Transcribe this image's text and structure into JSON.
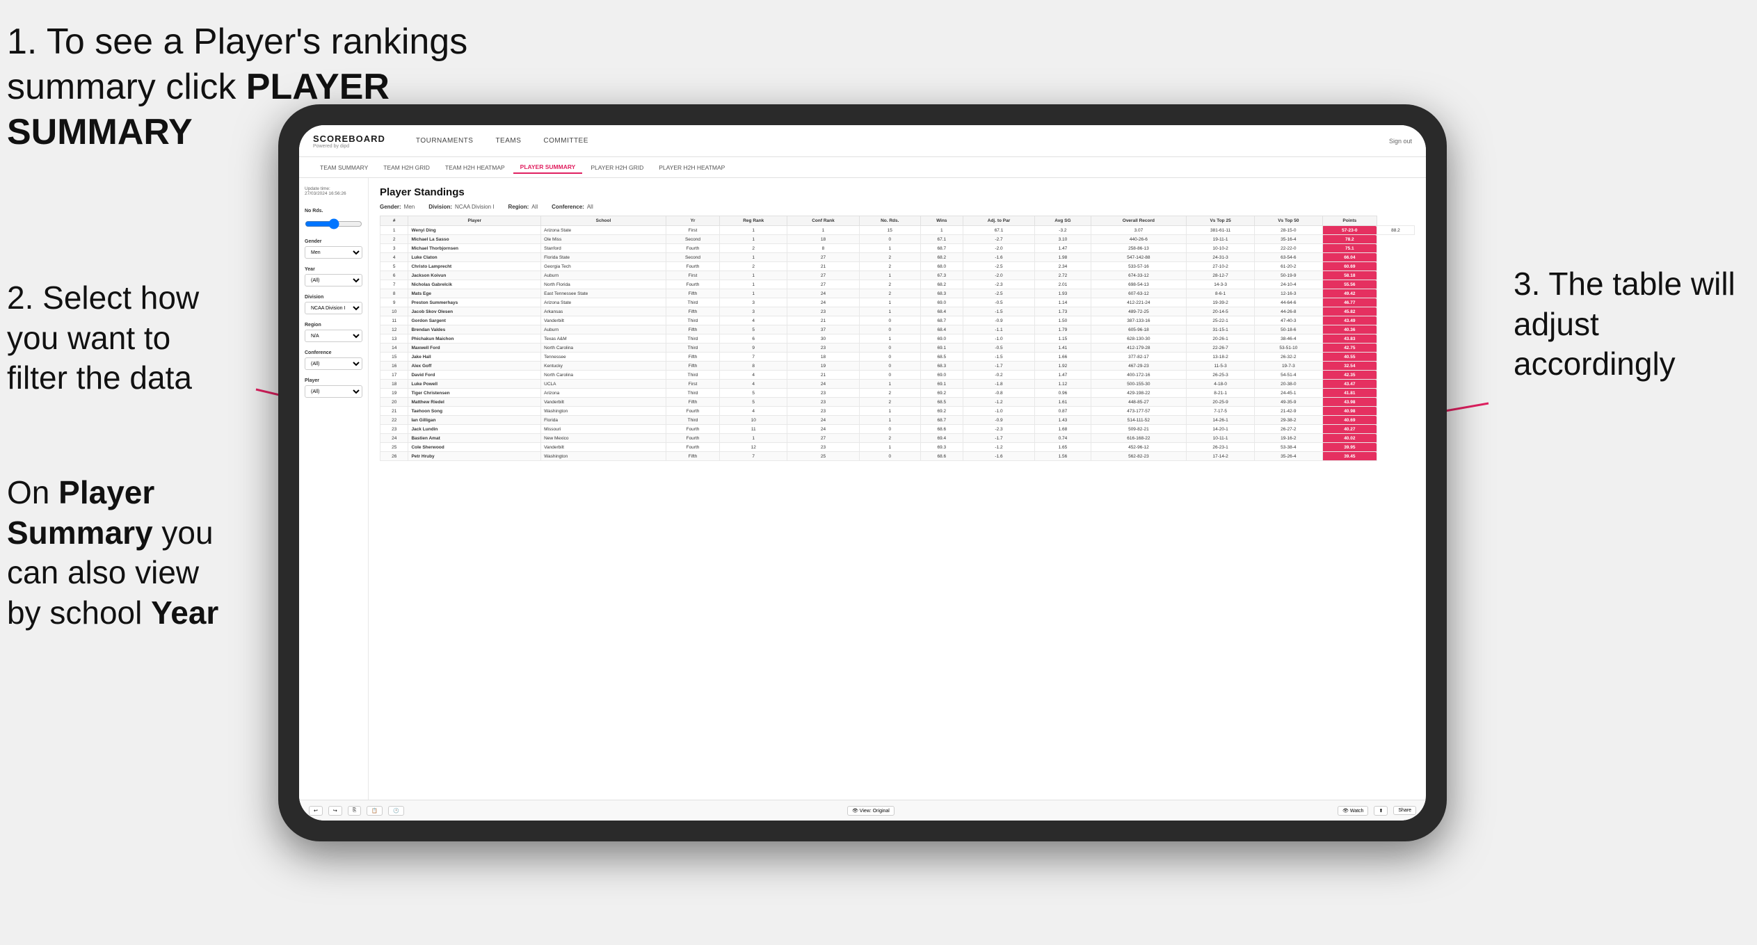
{
  "instructions": {
    "step1": {
      "text": "1. To see a Player's rankings summary click ",
      "bold": "PLAYER SUMMARY"
    },
    "step2": {
      "text": "2. Select how you want to filter the data"
    },
    "step3": {
      "text": "3. The table will adjust accordingly"
    },
    "step_bottom": {
      "prefix": "On ",
      "bold1": "Player Summary",
      "middle": " you can also view by school ",
      "bold2": "Year"
    }
  },
  "header": {
    "logo": "SCOREBOARD",
    "logo_sub": "Powered by dipd",
    "nav": [
      "TOURNAMENTS",
      "TEAMS",
      "COMMITTEE"
    ],
    "sign_in": "Sign out"
  },
  "subnav": {
    "items": [
      "TEAM SUMMARY",
      "TEAM H2H GRID",
      "TEAM H2H HEATMAP",
      "PLAYER SUMMARY",
      "PLAYER H2H GRID",
      "PLAYER H2H HEATMAP"
    ],
    "active": "PLAYER SUMMARY"
  },
  "sidebar": {
    "update_label": "Update time:",
    "update_time": "27/03/2024 16:56:26",
    "no_rds_label": "No Rds.",
    "gender_label": "Gender",
    "gender_value": "Men",
    "year_label": "Year",
    "year_value": "(All)",
    "division_label": "Division",
    "division_value": "NCAA Division I",
    "region_label": "Region",
    "region_value": "N/A",
    "conference_label": "Conference",
    "conference_value": "(All)",
    "player_label": "Player",
    "player_value": "(All)"
  },
  "standings": {
    "title": "Player Standings",
    "filters": {
      "gender_label": "Gender:",
      "gender_value": "Men",
      "division_label": "Division:",
      "division_value": "NCAA Division I",
      "region_label": "Region:",
      "region_value": "All",
      "conference_label": "Conference:",
      "conference_value": "All"
    },
    "columns": [
      "#",
      "Player",
      "School",
      "Yr",
      "Reg Rank",
      "Conf Rank",
      "No. Rds.",
      "Wins",
      "Adj. to Par",
      "Avg SG",
      "Overall Record",
      "Vs Top 25",
      "Vs Top 50",
      "Points"
    ],
    "rows": [
      [
        "1",
        "Wenyi Ding",
        "Arizona State",
        "First",
        "1",
        "1",
        "15",
        "1",
        "67.1",
        "-3.2",
        "3.07",
        "381-61-11",
        "28-15-0",
        "57-23-0",
        "88.2"
      ],
      [
        "2",
        "Michael La Sasso",
        "Ole Miss",
        "Second",
        "1",
        "18",
        "0",
        "67.1",
        "-2.7",
        "3.10",
        "440-26-6",
        "19-11-1",
        "35-16-4",
        "78.2"
      ],
      [
        "3",
        "Michael Thorbjornsen",
        "Stanford",
        "Fourth",
        "2",
        "8",
        "1",
        "68.7",
        "-2.0",
        "1.47",
        "258-86-13",
        "10-10-2",
        "22-22-0",
        "75.1"
      ],
      [
        "4",
        "Luke Claton",
        "Florida State",
        "Second",
        "1",
        "27",
        "2",
        "68.2",
        "-1.6",
        "1.98",
        "547-142-88",
        "24-31-3",
        "63-54-6",
        "66.04"
      ],
      [
        "5",
        "Christo Lamprecht",
        "Georgia Tech",
        "Fourth",
        "2",
        "21",
        "2",
        "68.0",
        "-2.5",
        "2.34",
        "533-57-16",
        "27-10-2",
        "61-20-2",
        "60.69"
      ],
      [
        "6",
        "Jackson Koivun",
        "Auburn",
        "First",
        "1",
        "27",
        "1",
        "67.3",
        "-2.0",
        "2.72",
        "674-33-12",
        "28-12-7",
        "50-19-9",
        "58.18"
      ],
      [
        "7",
        "Nicholas Gabrelcik",
        "North Florida",
        "Fourth",
        "1",
        "27",
        "2",
        "68.2",
        "-2.3",
        "2.01",
        "698-54-13",
        "14-3-3",
        "24-10-4",
        "55.56"
      ],
      [
        "8",
        "Mats Ege",
        "East Tennessee State",
        "Fifth",
        "1",
        "24",
        "2",
        "68.3",
        "-2.5",
        "1.93",
        "607-63-12",
        "8-6-1",
        "12-16-3",
        "49.42"
      ],
      [
        "9",
        "Preston Summerhays",
        "Arizona State",
        "Third",
        "3",
        "24",
        "1",
        "69.0",
        "-0.5",
        "1.14",
        "412-221-24",
        "19-39-2",
        "44-64-6",
        "46.77"
      ],
      [
        "10",
        "Jacob Skov Olesen",
        "Arkansas",
        "Fifth",
        "3",
        "23",
        "1",
        "68.4",
        "-1.5",
        "1.73",
        "489-72-25",
        "20-14-5",
        "44-26-8",
        "45.82"
      ],
      [
        "11",
        "Gordon Sargent",
        "Vanderbilt",
        "Third",
        "4",
        "21",
        "0",
        "68.7",
        "-0.9",
        "1.50",
        "387-133-16",
        "25-22-1",
        "47-40-3",
        "43.49"
      ],
      [
        "12",
        "Brendan Valdes",
        "Auburn",
        "Fifth",
        "5",
        "37",
        "0",
        "68.4",
        "-1.1",
        "1.79",
        "605-96-18",
        "31-15-1",
        "50-18-6",
        "40.36"
      ],
      [
        "13",
        "Phichakun Maichon",
        "Texas A&M",
        "Third",
        "6",
        "30",
        "1",
        "69.0",
        "-1.0",
        "1.15",
        "628-130-30",
        "20-26-1",
        "38-46-4",
        "43.83"
      ],
      [
        "14",
        "Maxwell Ford",
        "North Carolina",
        "Third",
        "9",
        "23",
        "0",
        "69.1",
        "-0.5",
        "1.41",
        "412-179-28",
        "22-26-7",
        "53-51-10",
        "42.75"
      ],
      [
        "15",
        "Jake Hall",
        "Tennessee",
        "Fifth",
        "7",
        "18",
        "0",
        "68.5",
        "-1.5",
        "1.66",
        "377-82-17",
        "13-18-2",
        "26-32-2",
        "40.55"
      ],
      [
        "16",
        "Alex Goff",
        "Kentucky",
        "Fifth",
        "8",
        "19",
        "0",
        "68.3",
        "-1.7",
        "1.92",
        "467-29-23",
        "11-5-3",
        "19-7-3",
        "32.54"
      ],
      [
        "17",
        "David Ford",
        "North Carolina",
        "Third",
        "4",
        "21",
        "0",
        "69.0",
        "-0.2",
        "1.47",
        "400-172-16",
        "26-25-3",
        "54-51-4",
        "42.35"
      ],
      [
        "18",
        "Luke Powell",
        "UCLA",
        "First",
        "4",
        "24",
        "1",
        "69.1",
        "-1.8",
        "1.12",
        "500-155-30",
        "4-18-0",
        "20-38-0",
        "43.47"
      ],
      [
        "19",
        "Tiger Christensen",
        "Arizona",
        "Third",
        "5",
        "23",
        "2",
        "69.2",
        "-0.8",
        "0.96",
        "429-198-22",
        "8-21-1",
        "24-45-1",
        "41.81"
      ],
      [
        "20",
        "Matthew Riedel",
        "Vanderbilt",
        "Fifth",
        "5",
        "23",
        "2",
        "68.5",
        "-1.2",
        "1.61",
        "448-85-27",
        "20-25-9",
        "49-35-9",
        "43.98"
      ],
      [
        "21",
        "Taehoon Song",
        "Washington",
        "Fourth",
        "4",
        "23",
        "1",
        "69.2",
        "-1.0",
        "0.87",
        "473-177-57",
        "7-17-5",
        "21-42-9",
        "40.98"
      ],
      [
        "22",
        "Ian Gilligan",
        "Florida",
        "Third",
        "10",
        "24",
        "1",
        "68.7",
        "-0.9",
        "1.43",
        "514-111-52",
        "14-26-1",
        "29-38-2",
        "40.69"
      ],
      [
        "23",
        "Jack Lundin",
        "Missouri",
        "Fourth",
        "11",
        "24",
        "0",
        "68.6",
        "-2.3",
        "1.68",
        "509-82-21",
        "14-20-1",
        "26-27-2",
        "40.27"
      ],
      [
        "24",
        "Bastien Amat",
        "New Mexico",
        "Fourth",
        "1",
        "27",
        "2",
        "69.4",
        "-1.7",
        "0.74",
        "616-168-22",
        "10-11-1",
        "19-16-2",
        "40.02"
      ],
      [
        "25",
        "Cole Sherwood",
        "Vanderbilt",
        "Fourth",
        "12",
        "23",
        "1",
        "69.3",
        "-1.2",
        "1.65",
        "452-96-12",
        "26-23-1",
        "53-38-4",
        "39.95"
      ],
      [
        "26",
        "Petr Hruby",
        "Washington",
        "Fifth",
        "7",
        "25",
        "0",
        "68.6",
        "-1.6",
        "1.56",
        "562-82-23",
        "17-14-2",
        "35-26-4",
        "39.45"
      ]
    ]
  },
  "toolbar": {
    "view_label": "View: Original",
    "watch_label": "Watch",
    "share_label": "Share"
  }
}
